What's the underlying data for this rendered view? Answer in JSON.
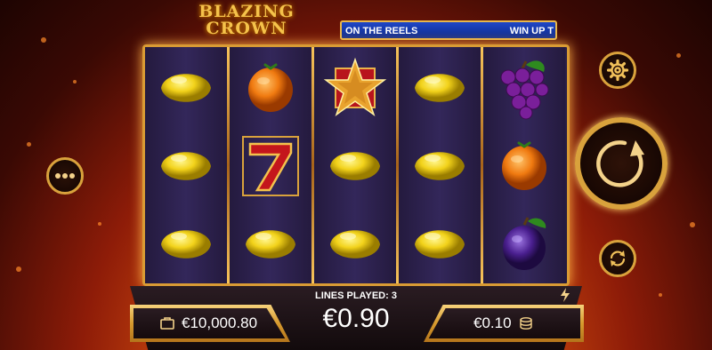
{
  "logo": {
    "line1": "BLAZING",
    "line2": "CROWN"
  },
  "ticker": {
    "left_text": "ON THE REELS",
    "right_text": "WIN UP T"
  },
  "reels": [
    [
      "lemon",
      "lemon",
      "lemon"
    ],
    [
      "orange",
      "seven",
      "lemon"
    ],
    [
      "star",
      "lemon",
      "lemon"
    ],
    [
      "lemon",
      "lemon",
      "lemon"
    ],
    [
      "grapes",
      "orange",
      "plum"
    ]
  ],
  "bottom": {
    "lines_played": "LINES PLAYED: 3",
    "total_bet": "€0.90",
    "balance": "€10,000.80",
    "stake": "€0.10"
  },
  "icons": {
    "settings": "gear-icon",
    "spin": "spin-icon",
    "autoplay": "autoplay-icon",
    "menu": "more-icon",
    "turbo": "lightning-icon",
    "balance": "wallet-icon",
    "stake": "coins-icon"
  },
  "colors": {
    "gold": "#d9a23c",
    "ticker_blue": "#1f47c8",
    "background": "#8e1c08"
  }
}
